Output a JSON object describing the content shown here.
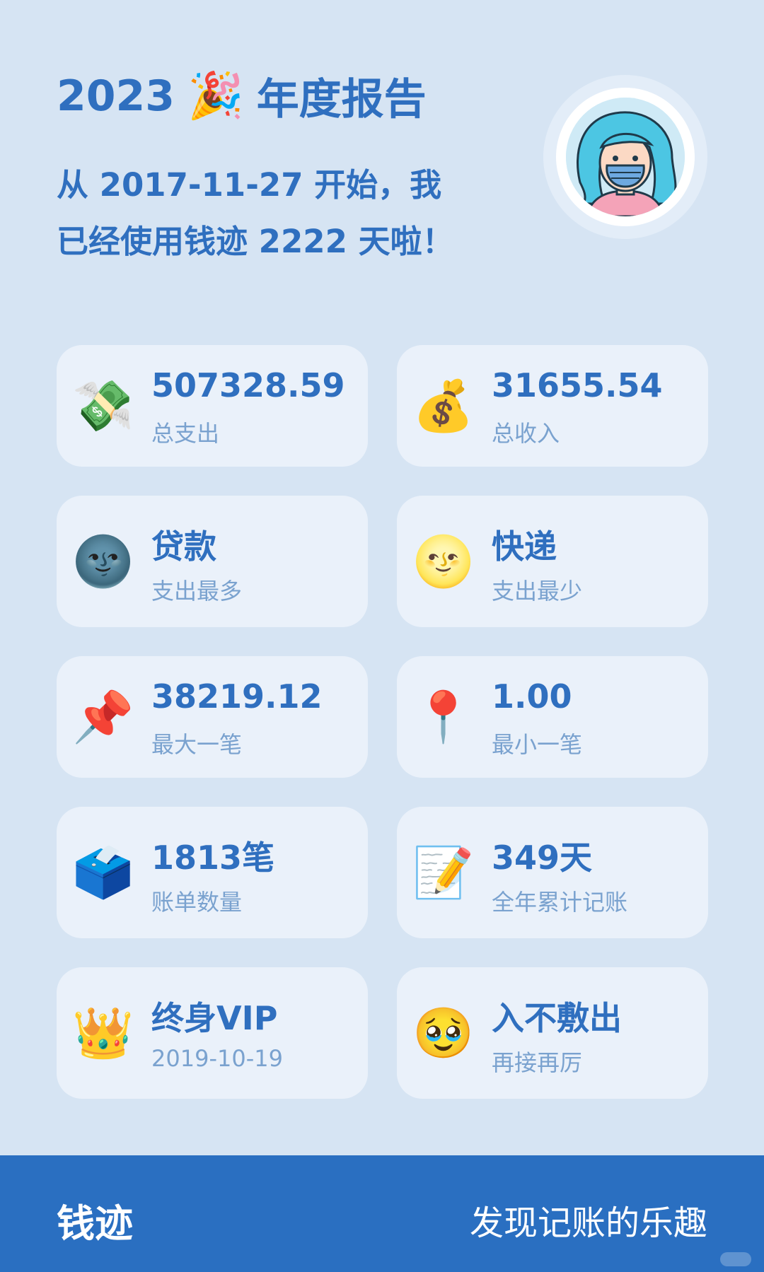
{
  "header": {
    "year": "2023",
    "party_emoji": "🎉",
    "title_suffix": "年度报告",
    "subtitle_line1": "从 2017-11-27 开始，我",
    "subtitle_line2": "已经使用钱迹 2222 天啦！"
  },
  "avatar": {
    "icon": "masked-girl-avatar-icon"
  },
  "cards": [
    {
      "icon": "💸",
      "icon_name": "money-with-wings-icon",
      "value": "507328.59",
      "label": "总支出"
    },
    {
      "icon": "💰",
      "icon_name": "money-bag-icon",
      "value": "31655.54",
      "label": "总收入"
    },
    {
      "icon": "🌚",
      "icon_name": "new-moon-face-icon",
      "value": "贷款",
      "label": "支出最多"
    },
    {
      "icon": "🌝",
      "icon_name": "full-moon-face-icon",
      "value": "快递",
      "label": "支出最少"
    },
    {
      "icon": "📌",
      "icon_name": "pushpin-icon",
      "value": "38219.12",
      "label": "最大一笔"
    },
    {
      "icon": "📍",
      "icon_name": "round-pushpin-icon",
      "value": "1.00",
      "label": "最小一笔"
    },
    {
      "icon": "🗳️",
      "icon_name": "ballot-box-icon",
      "value": "1813笔",
      "label": "账单数量"
    },
    {
      "icon": "📝",
      "icon_name": "memo-icon",
      "value": "349天",
      "label": "全年累计记账"
    },
    {
      "icon": "👑",
      "icon_name": "crown-icon",
      "value": "终身VIP",
      "label": "2019-10-19"
    },
    {
      "icon": "🥹",
      "icon_name": "face-holding-back-tears-icon",
      "value": "入不敷出",
      "label": "再接再厉"
    }
  ],
  "footer": {
    "brand": "钱迹",
    "slogan": "发现记账的乐趣"
  },
  "colors": {
    "background": "#d6e4f3",
    "card": "#eaf1fa",
    "accent": "#2f6fbf",
    "label": "#7aa2cf",
    "footer": "#2a6fc1"
  }
}
